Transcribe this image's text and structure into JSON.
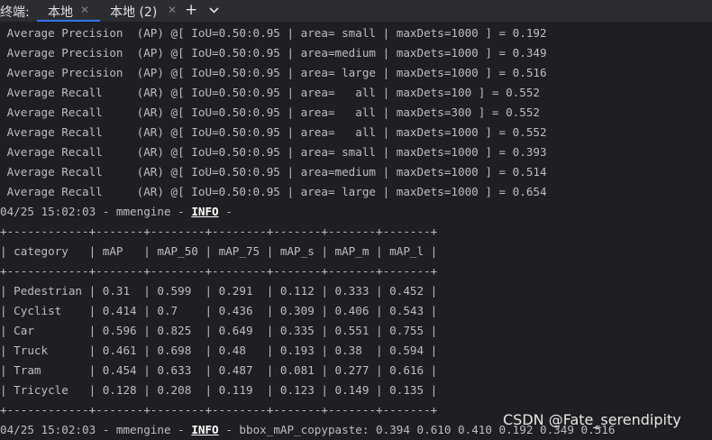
{
  "tabbar": {
    "label": "终端:",
    "tabs": [
      {
        "label": "本地",
        "active": true
      },
      {
        "label": "本地 (2)",
        "active": false
      }
    ],
    "add_icon": "plus-icon",
    "dropdown_icon": "chevron-down-icon"
  },
  "console": {
    "metric_lines": [
      " Average Precision  (AP) @[ IoU=0.50:0.95 | area= small | maxDets=1000 ] = 0.192",
      " Average Precision  (AP) @[ IoU=0.50:0.95 | area=medium | maxDets=1000 ] = 0.349",
      " Average Precision  (AP) @[ IoU=0.50:0.95 | area= large | maxDets=1000 ] = 0.516",
      " Average Recall     (AR) @[ IoU=0.50:0.95 | area=   all | maxDets=100 ] = 0.552",
      " Average Recall     (AR) @[ IoU=0.50:0.95 | area=   all | maxDets=300 ] = 0.552",
      " Average Recall     (AR) @[ IoU=0.50:0.95 | area=   all | maxDets=1000 ] = 0.552",
      " Average Recall     (AR) @[ IoU=0.50:0.95 | area= small | maxDets=1000 ] = 0.393",
      " Average Recall     (AR) @[ IoU=0.50:0.95 | area=medium | maxDets=1000 ] = 0.514",
      " Average Recall     (AR) @[ IoU=0.50:0.95 | area= large | maxDets=1000 ] = 0.654"
    ],
    "log1": {
      "prefix": "04/25 15:02:03 - mmengine - ",
      "level": "INFO",
      "suffix": " -"
    },
    "table": {
      "border": "+------------+-------+--------+--------+-------+-------+-------+",
      "header": "| category   | mAP   | mAP_50 | mAP_75 | mAP_s | mAP_m | mAP_l |",
      "rows": [
        "| Pedestrian | 0.31  | 0.599  | 0.291  | 0.112 | 0.333 | 0.452 |",
        "| Cyclist    | 0.414 | 0.7    | 0.436  | 0.309 | 0.406 | 0.543 |",
        "| Car        | 0.596 | 0.825  | 0.649  | 0.335 | 0.551 | 0.755 |",
        "| Truck      | 0.461 | 0.698  | 0.48   | 0.193 | 0.38  | 0.594 |",
        "| Tram       | 0.454 | 0.633  | 0.487  | 0.081 | 0.277 | 0.616 |",
        "| Tricycle   | 0.128 | 0.208  | 0.119  | 0.123 | 0.149 | 0.135 |"
      ]
    },
    "log2": {
      "prefix": "04/25 15:02:03 - mmengine - ",
      "level": "INFO",
      "suffix": " - bbox_mAP_copypaste: 0.394 0.610 0.410 0.192 0.349 0.516"
    }
  },
  "watermark": "CSDN @Fate_serendipity"
}
